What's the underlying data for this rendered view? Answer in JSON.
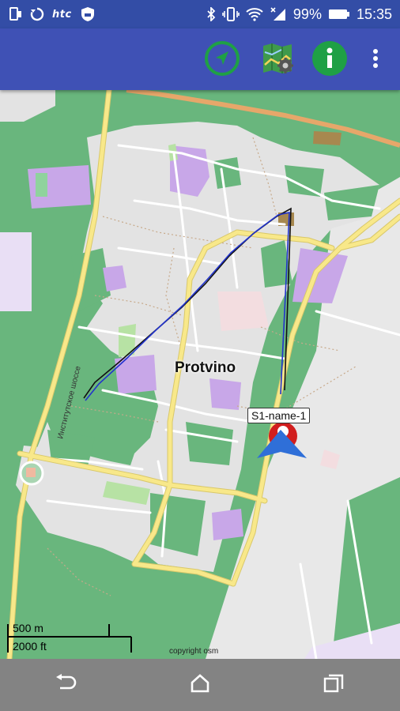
{
  "status_bar": {
    "left_icons": [
      "sim-icon",
      "sync-icon",
      "htc-logo",
      "shield-icon"
    ],
    "htc_text": "htc",
    "right_icons": [
      "bluetooth-icon",
      "vibrate-icon",
      "wifi-icon",
      "signal-icon",
      "battery-icon"
    ],
    "battery_percent": "99%",
    "time": "15:35"
  },
  "toolbar": {
    "buttons": [
      "navigation-arrow-icon",
      "map-settings-icon",
      "info-icon",
      "more-vert-icon"
    ],
    "accent_color": "#1fa045"
  },
  "map": {
    "city_label": "Protvino",
    "road_label": "Институтское шоссе",
    "marker_label": "S1-name-1",
    "scale_top": "500 m",
    "scale_bottom": "2000 ft",
    "copyright": "copyright osm",
    "colors": {
      "forest": "#69b67d",
      "built_area": "#e3e3e3",
      "road_major": "#f8e88a",
      "road_minor": "#ffffff",
      "industrial": "#c8a7e8",
      "railway_orange": "#e6a76a",
      "track_blue": "#2233cc",
      "track_black": "#111111",
      "marker_red": "#d11e1e",
      "marker_blue": "#2f6fd8"
    }
  },
  "nav_bar": {
    "buttons": [
      "back-icon",
      "home-icon",
      "recent-apps-icon"
    ]
  }
}
